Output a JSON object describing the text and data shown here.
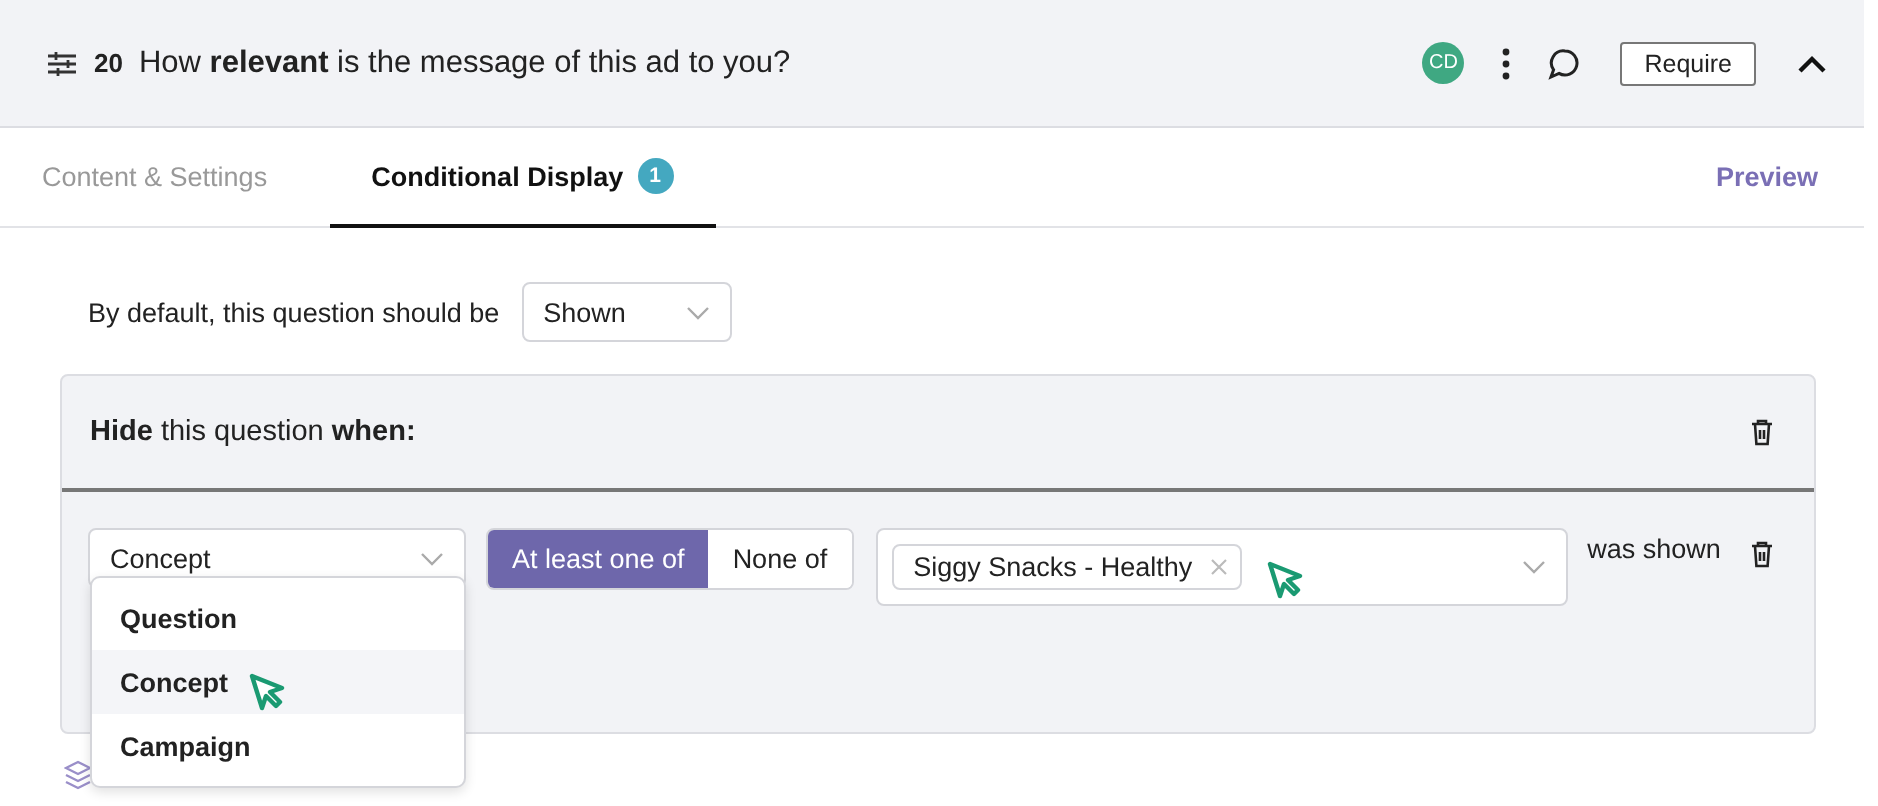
{
  "question": {
    "number": "20",
    "text": "How **relevant** is the message of this ad to you?",
    "avatar": "CD",
    "require_button": "Require"
  },
  "tabs": [
    {
      "label": "Content & Settings",
      "selected": false
    },
    {
      "label": "Conditional Display",
      "selected": true,
      "badge": "1"
    }
  ],
  "preview_link": "Preview",
  "default_visibility": {
    "label": "By default, this question should be",
    "value": "Shown"
  },
  "rule": {
    "title": "**Hide** this question **when:**",
    "condition": {
      "type_value": "Concept",
      "modes": [
        {
          "label": "At least one of",
          "selected": true
        },
        {
          "label": "None of",
          "selected": false
        }
      ],
      "tags": [
        "Siggy Snacks - Healthy"
      ],
      "suffix": "was shown"
    }
  },
  "type_menu": {
    "options": [
      {
        "label": "Question",
        "highlighted": false
      },
      {
        "label": "Concept",
        "highlighted": true
      },
      {
        "label": "Campaign",
        "highlighted": false
      }
    ]
  }
}
